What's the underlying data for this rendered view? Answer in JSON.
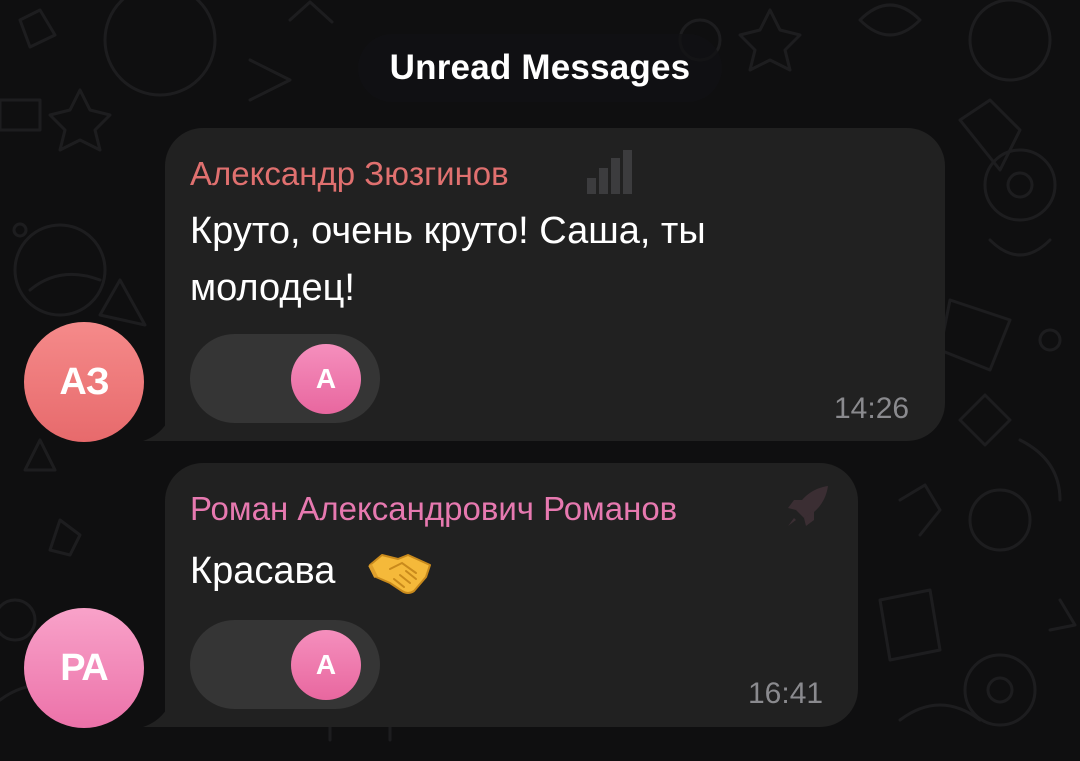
{
  "unread_label": "Unread Messages",
  "messages": [
    {
      "sender": "Александр Зюзгинов",
      "sender_color": "#e0706f",
      "status_icon": "signal-bars-icon",
      "text": "Круто, очень круто! Саша, ты молодец!",
      "reaction_avatar": "A",
      "time": "14:26",
      "avatar_initials": "АЗ",
      "avatar_color": "#ec7375"
    },
    {
      "sender": "Роман Александрович Романов",
      "sender_color": "#e779b0",
      "status_icon": "rocket-icon",
      "text": "Красава",
      "emoji": "handshake-emoji",
      "reaction_avatar": "A",
      "time": "16:41",
      "avatar_initials": "РА",
      "avatar_color": "#f085b6"
    }
  ]
}
